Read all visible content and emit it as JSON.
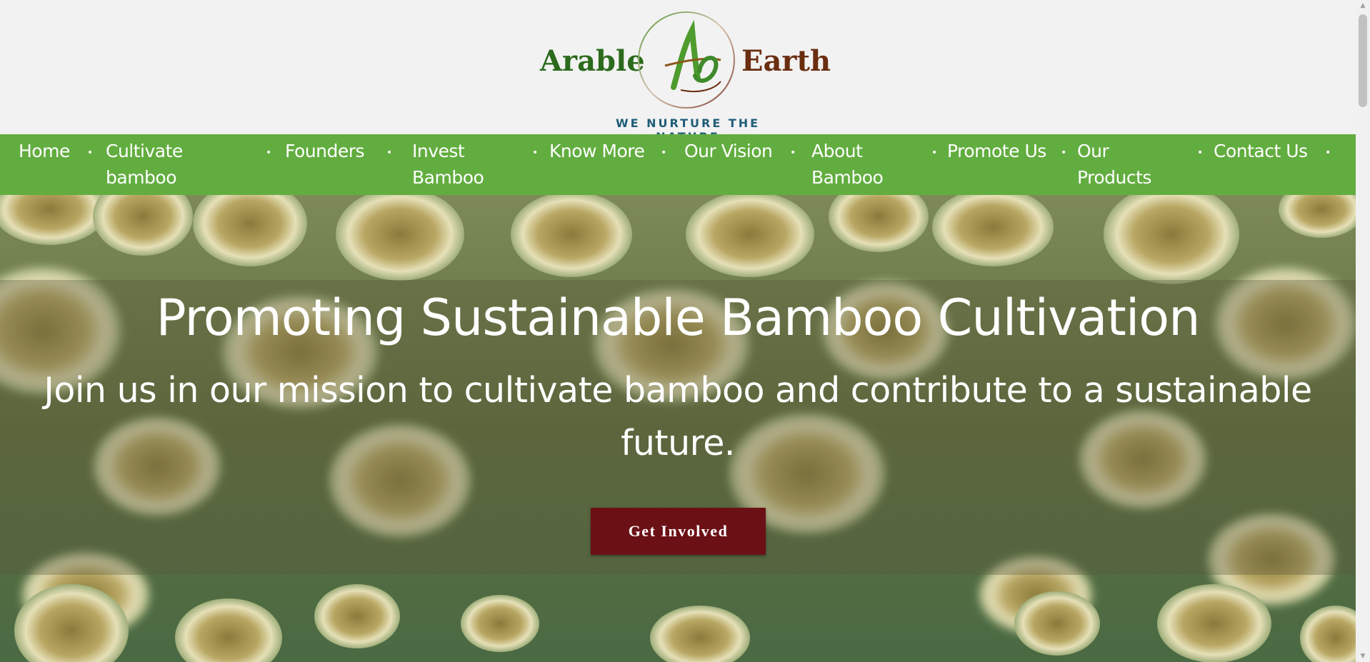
{
  "brand": {
    "name_left": "Arable",
    "name_right": "Earth",
    "monogram": "Ae",
    "tagline": "WE NURTURE THE NATURE"
  },
  "nav": {
    "items": [
      {
        "label": "Home"
      },
      {
        "label": "Cultivate bamboo"
      },
      {
        "label": "Founders"
      },
      {
        "label": "Invest Bamboo"
      },
      {
        "label": "Know More"
      },
      {
        "label": "Our Vision"
      },
      {
        "label": "About Bamboo"
      },
      {
        "label": "Promote Us"
      },
      {
        "label": "Our Products"
      },
      {
        "label": "Contact Us"
      }
    ],
    "separator": "•"
  },
  "hero": {
    "title": "Promoting Sustainable Bamboo Cultivation",
    "subtitle": "Join us in our mission to cultivate bamboo and contribute to a sustainable future.",
    "cta_label": "Get Involved"
  },
  "colors": {
    "nav_bg": "#62ad3f",
    "cta_bg": "#6b1116",
    "tagline": "#1f5d78",
    "brand_green": "#2c6a1c",
    "brand_brown": "#6a2d10"
  },
  "icons": {
    "scroll_up": "scroll-up-arrow-icon",
    "scroll_down": "scroll-down-arrow-icon"
  }
}
